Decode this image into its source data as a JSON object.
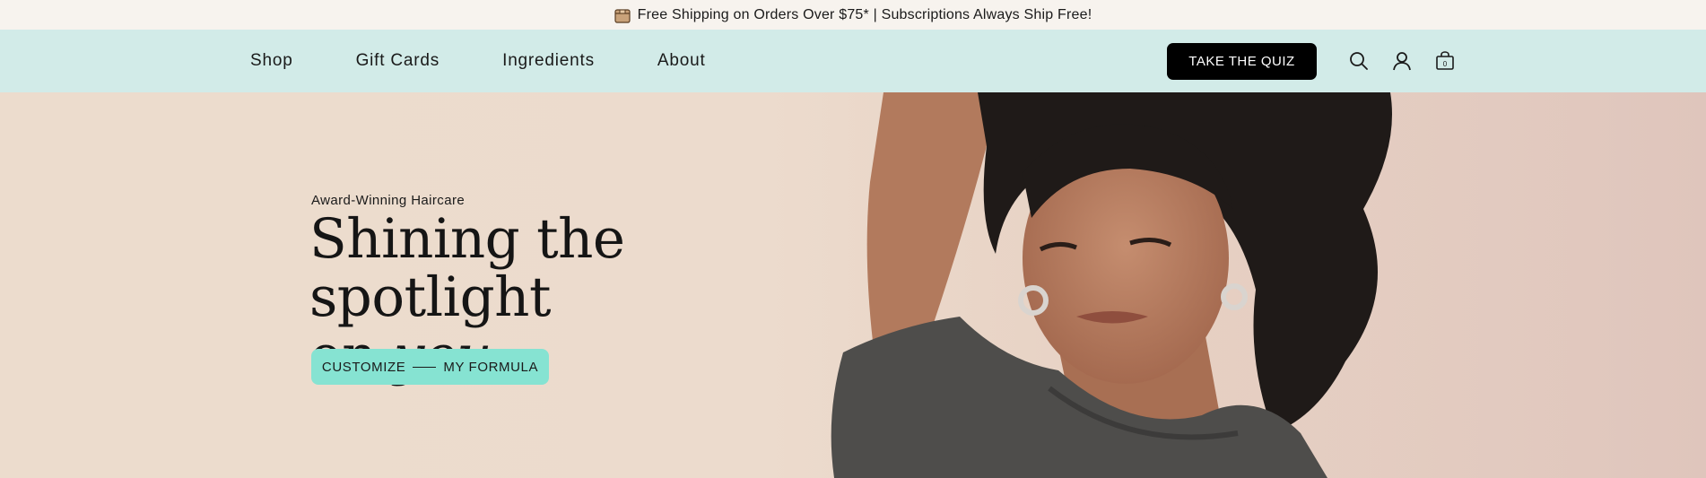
{
  "announcement": {
    "text": "Free Shipping on Orders Over $75* | Subscriptions Always Ship Free!",
    "icon": "package-icon"
  },
  "nav": {
    "links": [
      {
        "label": "Shop"
      },
      {
        "label": "Gift Cards"
      },
      {
        "label": "Ingredients"
      },
      {
        "label": "About"
      }
    ],
    "quiz_button": "TAKE THE QUIZ",
    "cart_count": "0",
    "icons": [
      "search-icon",
      "account-icon",
      "cart-icon"
    ]
  },
  "hero": {
    "eyebrow": "Award-Winning Haircare",
    "headline_line1": "Shining the spotlight",
    "headline_line2_plain": "on ",
    "headline_line2_italic": "you",
    "cta_left": "CUSTOMIZE",
    "cta_right": "MY FORMULA"
  },
  "colors": {
    "nav_bg": "#d2ebe8",
    "announce_bg": "#f7f3ee",
    "cta_bg": "#86e3d2",
    "quiz_bg": "#000000",
    "hero_bg": "#ecdbcd"
  }
}
